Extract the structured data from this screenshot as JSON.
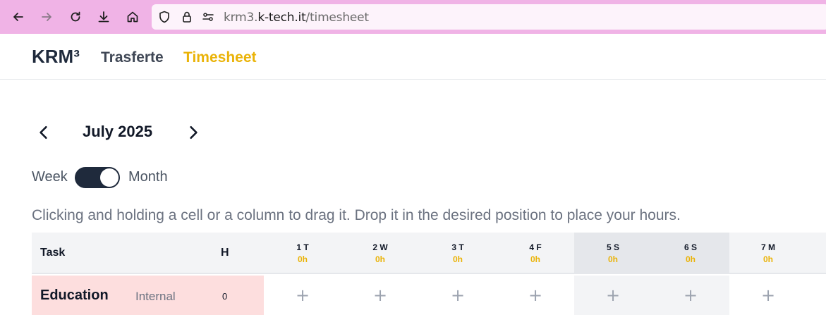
{
  "browser": {
    "url_prefix": "krm3.",
    "url_host": "k-tech.it",
    "url_path": "/timesheet",
    "icons": [
      "back-arrow-icon",
      "forward-arrow-icon",
      "reload-icon",
      "download-icon",
      "home-icon",
      "shield-icon",
      "lock-icon",
      "permissions-icon"
    ]
  },
  "header": {
    "brand": "KRM³",
    "nav": [
      {
        "label": "Trasferte",
        "active": false
      },
      {
        "label": "Timesheet",
        "active": true
      }
    ]
  },
  "calendar": {
    "month_label": "July 2025",
    "prev_icon": "chevron-left-icon",
    "next_icon": "chevron-right-icon"
  },
  "view_toggle": {
    "left_label": "Week",
    "right_label": "Month",
    "selected": "Month"
  },
  "instruction": "Clicking and holding a cell or a column to drag it. Drop it in the desired position to place your hours.",
  "table": {
    "task_header": "Task",
    "hours_header": "H",
    "days": [
      {
        "label": "1 T",
        "hours": "0h",
        "weekend": false
      },
      {
        "label": "2 W",
        "hours": "0h",
        "weekend": false
      },
      {
        "label": "3 T",
        "hours": "0h",
        "weekend": false
      },
      {
        "label": "4 F",
        "hours": "0h",
        "weekend": false
      },
      {
        "label": "5 S",
        "hours": "0h",
        "weekend": true
      },
      {
        "label": "6 S",
        "hours": "0h",
        "weekend": true
      },
      {
        "label": "7 M",
        "hours": "0h",
        "weekend": false
      }
    ],
    "rows": [
      {
        "task": "Education",
        "type": "Internal",
        "hours": "0",
        "cell_symbol": "+"
      }
    ]
  },
  "colors": {
    "browser_bar": "#f0b3e6",
    "brand": "#1f2a3c",
    "accent": "#eab308",
    "row_highlight": "#fddede"
  }
}
